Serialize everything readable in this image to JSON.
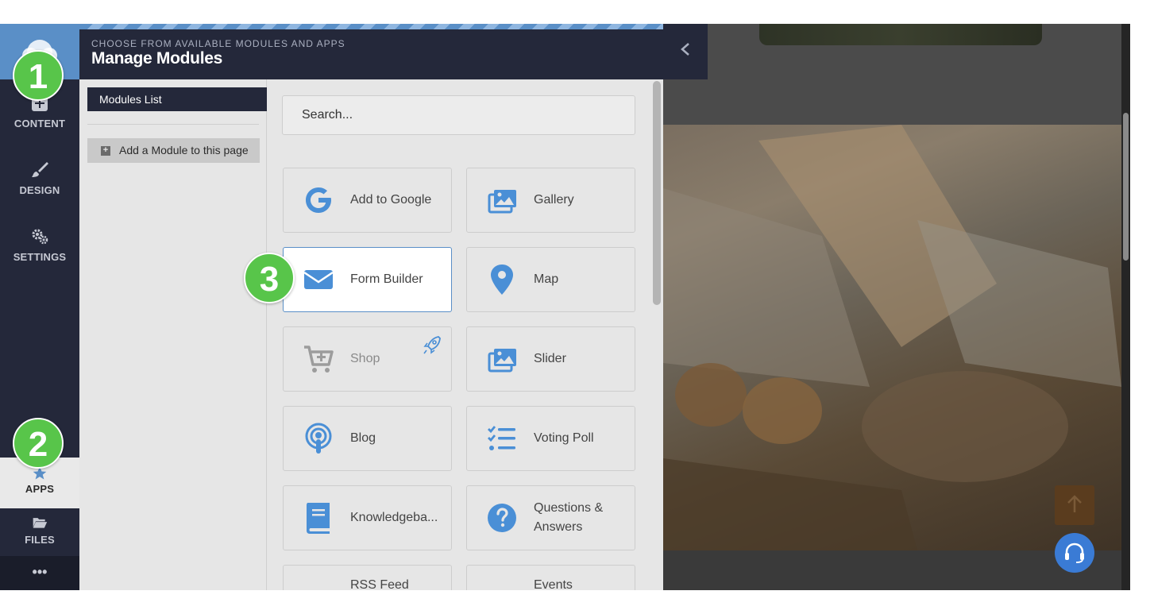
{
  "header": {
    "subtitle": "CHOOSE FROM AVAILABLE MODULES AND APPS",
    "title": "Manage Modules"
  },
  "sidebar": {
    "items": [
      {
        "label": "CONTENT",
        "icon": "plus-square-icon"
      },
      {
        "label": "DESIGN",
        "icon": "paintbrush-icon"
      },
      {
        "label": "SETTINGS",
        "icon": "gears-icon"
      },
      {
        "label": "APPS",
        "icon": "star-icon"
      },
      {
        "label": "FILES",
        "icon": "folder-open-icon"
      }
    ],
    "more": "•••"
  },
  "markers": [
    "1",
    "2",
    "3"
  ],
  "nav": {
    "modules_list": "Modules List",
    "add_module": "Add a Module to this page"
  },
  "search": {
    "placeholder": "Search..."
  },
  "modules": [
    {
      "label": "Add to Google",
      "icon": "google-icon"
    },
    {
      "label": "Gallery",
      "icon": "images-icon"
    },
    {
      "label": "Form Builder",
      "icon": "envelope-icon"
    },
    {
      "label": "Map",
      "icon": "map-pin-icon"
    },
    {
      "label": "Shop",
      "icon": "cart-plus-icon"
    },
    {
      "label": "Slider",
      "icon": "images-icon"
    },
    {
      "label": "Blog",
      "icon": "podcast-icon"
    },
    {
      "label": "Voting Poll",
      "icon": "checklist-icon"
    },
    {
      "label": "Knowledgeba...",
      "icon": "book-icon"
    },
    {
      "label": "Questions & Answers",
      "icon": "question-circle-icon"
    },
    {
      "label": "RSS Feed",
      "icon": "rss-icon"
    },
    {
      "label": "Events",
      "icon": "calendar-icon"
    }
  ],
  "colors": {
    "accent": "#5a8fc7",
    "sidebar": "#24283a",
    "marker": "#58c54a"
  }
}
